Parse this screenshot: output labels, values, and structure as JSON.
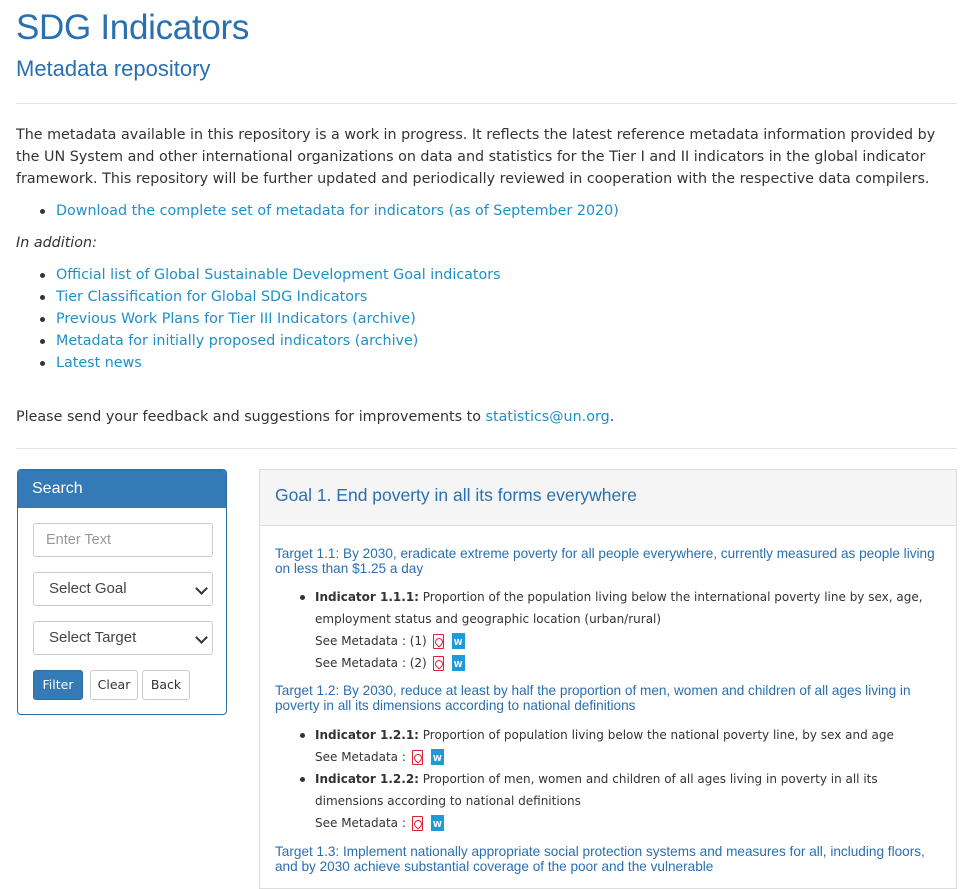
{
  "header": {
    "title": "SDG Indicators",
    "subtitle": "Metadata repository"
  },
  "intro": {
    "text": "The metadata available in this repository is a work in progress. It reflects the latest reference metadata information provided by the UN System and other international organizations on data and statistics for the Tier I and II indicators in the global indicator framework. This repository will be further updated and periodically reviewed in cooperation with the respective data compilers.",
    "download_link": "Download the complete set of metadata for indicators (as of September 2020)",
    "in_addition": "In addition:",
    "links": [
      "Official list of Global Sustainable Development Goal indicators",
      "Tier Classification for Global SDG Indicators",
      "Previous Work Plans for Tier III Indicators (archive)",
      "Metadata for initially proposed indicators (archive)",
      "Latest news"
    ],
    "feedback_prefix": "Please send your feedback and suggestions for improvements to ",
    "feedback_email": "statistics@un.org",
    "feedback_suffix": "."
  },
  "search": {
    "title": "Search",
    "text_placeholder": "Enter Text",
    "goal_select": "Select Goal",
    "target_select": "Select Target",
    "filter_label": "Filter",
    "clear_label": "Clear",
    "back_label": "Back"
  },
  "goal": {
    "title": "Goal 1. End poverty in all its forms everywhere",
    "targets": [
      {
        "text": "Target 1.1: By 2030, eradicate extreme poverty for all people everywhere, currently measured as people living on less than $1.25 a day",
        "indicators": [
          {
            "code": "Indicator 1.1.1:",
            "text": " Proportion of the population living below the international poverty line by sex, age, employment status and geographic location (urban/rural)",
            "metadata": [
              "See Metadata : (1)",
              "See Metadata : (2)"
            ]
          }
        ]
      },
      {
        "text": "Target 1.2: By 2030, reduce at least by half the proportion of men, women and children of all ages living in poverty in all its dimensions according to national definitions",
        "indicators": [
          {
            "code": "Indicator 1.2.1:",
            "text": " Proportion of population living below the national poverty line, by sex and age",
            "metadata": [
              "See Metadata :"
            ]
          },
          {
            "code": "Indicator 1.2.2:",
            "text": " Proportion of men, women and children of all ages living in poverty in all its dimensions according to national definitions",
            "metadata": [
              "See Metadata :"
            ]
          }
        ]
      },
      {
        "text": "Target 1.3: Implement nationally appropriate social protection systems and measures for all, including floors, and by 2030 achieve substantial coverage of the poor and the vulnerable"
      }
    ]
  },
  "colors": {
    "heading": "#2a6fb0",
    "link": "#1f8fc7",
    "primary": "#337ab7",
    "pdf": "#d9232d",
    "word": "#1d9bd8"
  }
}
